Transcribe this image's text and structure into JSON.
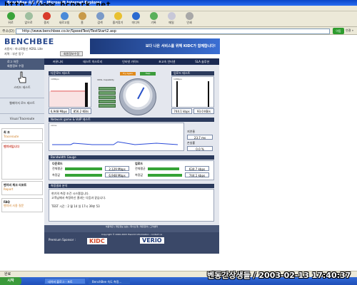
{
  "window": {
    "title": "BenchBee 속도 측정 - Microsoft Internet Explorer",
    "watermark": "http://www.bcpark.net"
  },
  "toolbar": {
    "buttons": [
      {
        "label": "뒤로",
        "icon": "back-icon"
      },
      {
        "label": "앞으로",
        "icon": "forward-icon"
      },
      {
        "label": "중지",
        "icon": "stop-icon"
      },
      {
        "label": "새로고침",
        "icon": "refresh-icon"
      },
      {
        "label": "홈",
        "icon": "home-icon"
      },
      {
        "label": "검색",
        "icon": "search-icon"
      },
      {
        "label": "즐겨찾기",
        "icon": "favorites-icon"
      },
      {
        "label": "미디어",
        "icon": "media-icon"
      },
      {
        "label": "기록",
        "icon": "history-icon"
      },
      {
        "label": "메일",
        "icon": "mail-icon"
      },
      {
        "label": "인쇄",
        "icon": "print-icon"
      }
    ]
  },
  "address": {
    "label": "주소(D)",
    "url": "http://www.benchbee.co.kr/SpeedTest/TestStart2.asp",
    "go": "이동",
    "links": "연결 »"
  },
  "page": {
    "logo": "BENCHBEE",
    "login_line": "사용자 : 하나로통신 ADSL Lite",
    "login_line2": "지역 : 부산 동구",
    "customer_button": "회원정보수정",
    "banner_text": "보다 나은 서비스를 위해 KIDC가 함께합니다!",
    "nav": [
      "커뮤니티",
      "테스트 히스토리",
      "인터넷 가이드",
      "초고속 인터넷",
      "SLA 솔루션"
    ],
    "sidebar": {
      "header1": "로그 아웃",
      "header2": "회원정보 수정",
      "speed_test": "스피드 테스트",
      "bandwidth_test": "웹페이지 로드 테스트",
      "trace_test": "Visual Traceroute",
      "box1_title": "최 초",
      "box1_sub": "Traceroute",
      "box2_title": "벤치비입니다",
      "box3_title": "벤치비 체크 리포트",
      "box3_sub": "Report",
      "box4_title": "FAQ",
      "box4_sub": "벤치비 사용 질문"
    },
    "test": {
      "download_title": "다운로드 테스트",
      "upload_title": "업로드 테스트",
      "download_speed": "6,948 Mbps",
      "download_speed2": "856.2 KB/s",
      "upload_speed": "744.1 kbps",
      "upload_speed2": "93.0 KB/s",
      "gauge_label": "VDSL Capability",
      "try_again": "Try Again",
      "help": "Help",
      "graph_tag_left": "10Mbps",
      "graph_tag_right": "10Mbps",
      "voip_title": "Network game & VoIP 테스트",
      "voip_tag": "10ms",
      "latency_label": "지연율",
      "latency_value": "23.7 ms",
      "loss_label": "손실률",
      "loss_value": "0.0 %",
      "bandwidth_title": "Bandwidth Gauge",
      "down_label": "다운로드",
      "up_label": "업로드",
      "rows": [
        {
          "left_label": "전체평균",
          "left_value": "2,129 Mbps",
          "right_label": "전체평균",
          "right_value": "634.7 kbps"
        },
        {
          "left_label": "측정값",
          "left_value": "6,948 Mbps",
          "right_label": "측정값",
          "right_value": "744.1 kbps"
        }
      ],
      "result_title": "측정결과 분석",
      "result_lines": [
        "현기의 측정 조건 시스템입니다.",
        "고객님께서 측정하신 결과는 다음과 같습니다.",
        "",
        "TEST 시간 :         2 월 14 일   17시 39분 53"
      ]
    },
    "footer": {
      "links": [
        "이용약관",
        "개인정보 보호",
        "회사소개",
        "제휴문의",
        "고객센터"
      ],
      "copyright": "Copyright © 2000-2003 Hiworld Information . contact us",
      "sponsor_label": "Premium Sponsor :",
      "sponsor1": "KIDC",
      "sponsor2": "VERIO"
    }
  },
  "statusbar": {
    "text": "완료"
  },
  "taskbar": {
    "start": "시작",
    "items": [
      "네이버 블로그 - 포토",
      "BenchBee 속도 측정..."
    ]
  },
  "overlay_timestamp": "벤동간상생들 / 2003-02-13 17:40:37",
  "colors": {
    "nav_bg": "#1b2a52",
    "bar_green": "#36a336",
    "accent_orange": "#e08a1c"
  }
}
